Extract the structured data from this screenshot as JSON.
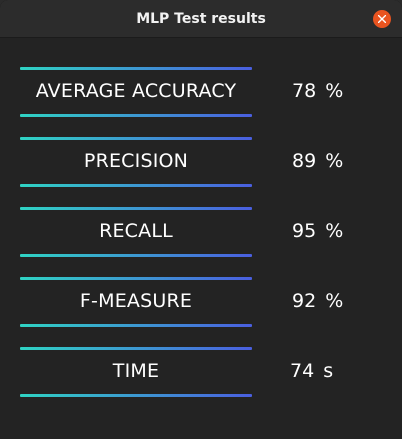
{
  "window": {
    "title": "MLP Test results"
  },
  "metrics": [
    {
      "label": "AVERAGE  ACCURACY",
      "value": "78",
      "unit": "%"
    },
    {
      "label": "PRECISION",
      "value": "89",
      "unit": "%"
    },
    {
      "label": "RECALL",
      "value": "95",
      "unit": "%"
    },
    {
      "label": "F-MEASURE",
      "value": "92",
      "unit": "%"
    },
    {
      "label": "TIME",
      "value": "74",
      "unit": "s"
    }
  ],
  "colors": {
    "line_gradient_start": "#2fd3c3",
    "line_gradient_end": "#4a5fe0",
    "close_button": "#e95420"
  },
  "icons": {
    "close": "close-icon"
  }
}
